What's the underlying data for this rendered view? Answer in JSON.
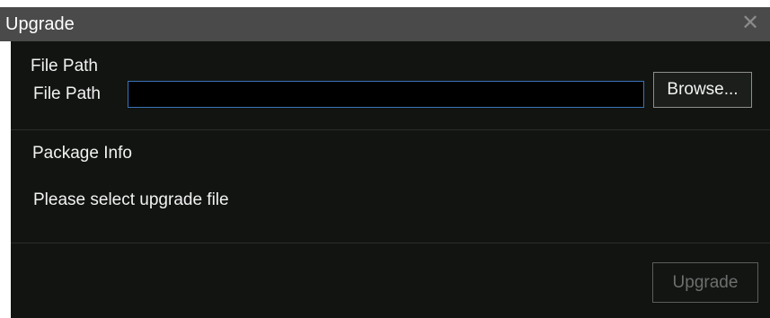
{
  "window": {
    "title": "Upgrade",
    "close_glyph": "✕"
  },
  "file_path": {
    "section_title": "File Path",
    "field_label": "File Path",
    "value": "",
    "browse_label": "Browse..."
  },
  "package_info": {
    "section_title": "Package Info",
    "message": "Please select upgrade file"
  },
  "actions": {
    "upgrade_label": "Upgrade"
  },
  "colors": {
    "titlebar": "#4a4a4a",
    "panel": "#111411",
    "input_border": "#3a74b8",
    "disabled_text": "#6e6e6e"
  }
}
